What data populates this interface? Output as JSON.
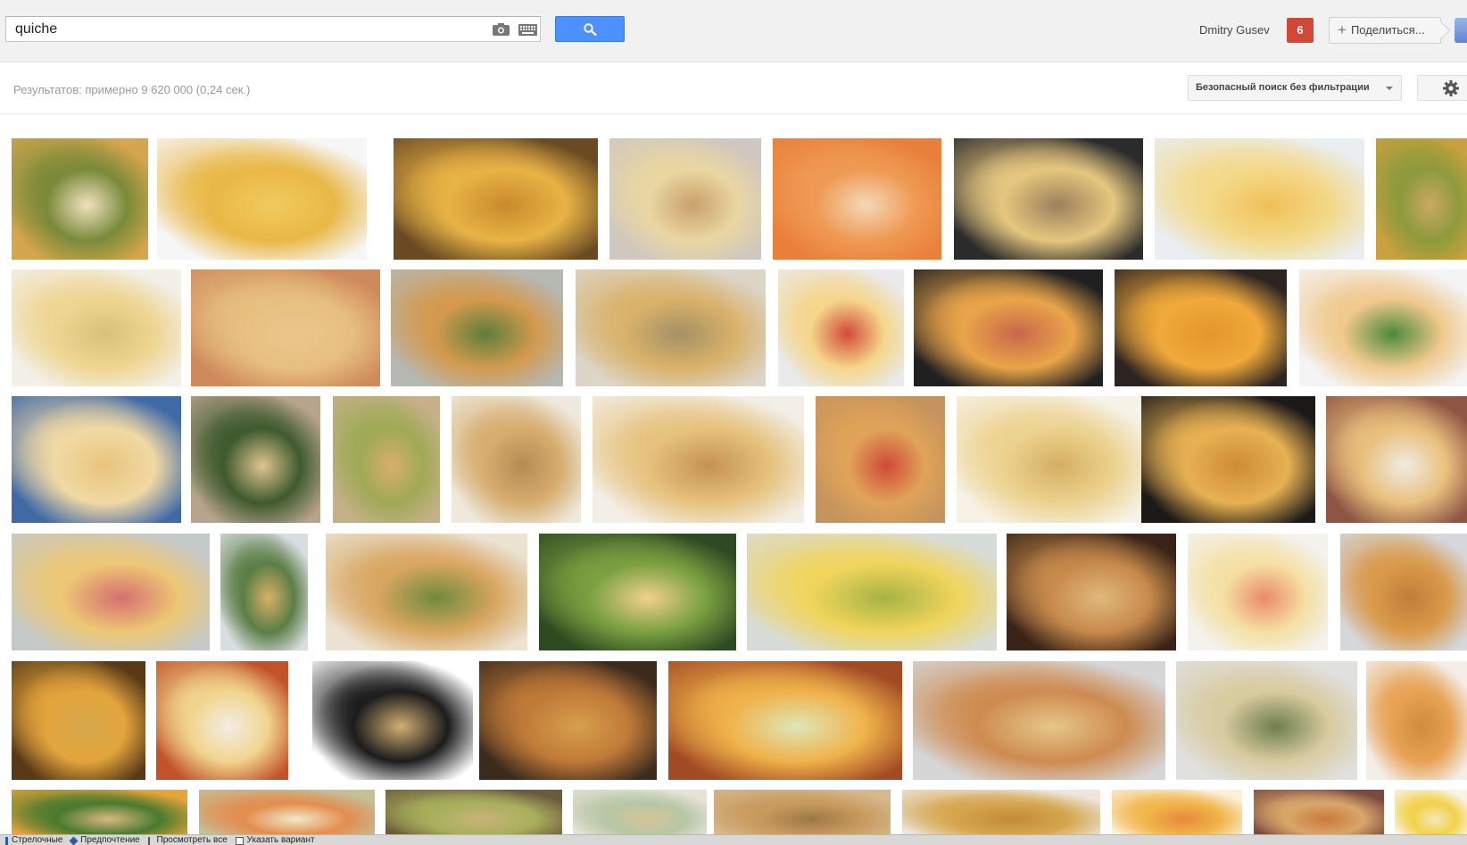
{
  "header": {
    "search_query": "quiche",
    "user_name": "Dmitry Gusev",
    "notifications": "6",
    "share_label": "Поделиться..."
  },
  "icons": {
    "camera": "camera-icon",
    "keyboard": "keyboard-icon",
    "search": "magnifier-icon",
    "settings": "gear-icon"
  },
  "colors": {
    "search_button": "#4d90fe",
    "notification_badge": "#d14836",
    "topbar_bg": "#f1f1f1"
  },
  "results": {
    "count_text": "Результатов: примерно 9 620 000 (0,24 сек.)",
    "safesearch_label": "Безопасный поиск без фильтрации"
  },
  "image_results": [
    [
      {
        "colors": [
          "#d5a64d",
          "#7a8a3a",
          "#f0e2c0"
        ]
      },
      {
        "colors": [
          "#f6f6f6",
          "#e9b845",
          "#f1ca5f"
        ]
      },
      {
        "colors": [
          "#6a4a22",
          "#e8b345",
          "#c98a2c"
        ]
      },
      {
        "colors": [
          "#cfc7c0",
          "#e9d6a2",
          "#c9a06a"
        ]
      },
      {
        "colors": [
          "#e87f3a",
          "#ef9a54",
          "#f4d8b8"
        ]
      },
      {
        "colors": [
          "#2c2b2b",
          "#e5c77f",
          "#9d7f5c"
        ]
      },
      {
        "colors": [
          "#eaeef0",
          "#f3d98a",
          "#f0c058"
        ]
      },
      {
        "colors": [
          "#c9a140",
          "#8e9a3c",
          "#caa962"
        ]
      }
    ],
    [
      {
        "colors": [
          "#f3f0e8",
          "#eed591",
          "#d8c07a"
        ]
      },
      {
        "colors": [
          "#cf8a5c",
          "#e7c080",
          "#eac58c"
        ]
      },
      {
        "colors": [
          "#b6b8b2",
          "#d39a4e",
          "#5d7e3d"
        ]
      },
      {
        "colors": [
          "#ddd5c8",
          "#d9b26a",
          "#a59066"
        ]
      },
      {
        "colors": [
          "#eaeaea",
          "#f5d68a",
          "#d24a3a"
        ]
      },
      {
        "colors": [
          "#202020",
          "#e9a549",
          "#c9674a"
        ]
      },
      {
        "colors": [
          "#2c2421",
          "#f0a93a",
          "#e3962c"
        ]
      },
      {
        "colors": [
          "#f4f4f4",
          "#f0c98d",
          "#4a8a3a"
        ]
      }
    ],
    [
      {
        "colors": [
          "#3f6aa6",
          "#f1d9a4",
          "#e8c47d"
        ]
      },
      {
        "colors": [
          "#b7a48c",
          "#3f5a2e",
          "#dfc590"
        ]
      },
      {
        "colors": [
          "#c6b08a",
          "#9faa56",
          "#d9ae6c"
        ]
      },
      {
        "colors": [
          "#efe9dd",
          "#d6ad6e",
          "#b58b55"
        ]
      },
      {
        "colors": [
          "#f3efe7",
          "#e6c27d",
          "#c49254"
        ]
      },
      {
        "colors": [
          "#c5935d",
          "#e0a359",
          "#cf4a3a"
        ]
      },
      {
        "colors": [
          "#f7f2e6",
          "#ecd28e",
          "#d5ae62"
        ]
      },
      {
        "colors": [
          "#1c1a18",
          "#e7b152",
          "#cf8b35"
        ]
      },
      {
        "colors": [
          "#8e5545",
          "#e9c07d",
          "#f1ebe2"
        ]
      }
    ],
    [
      {
        "colors": [
          "#c4c9c8",
          "#edc775",
          "#d66f6f"
        ]
      },
      {
        "colors": [
          "#d8dde0",
          "#5c7e46",
          "#d7b168"
        ]
      },
      {
        "colors": [
          "#ece2d2",
          "#d8a660",
          "#6f8a3c"
        ]
      },
      {
        "colors": [
          "#2d4a22",
          "#7aa040",
          "#f0d28a"
        ]
      },
      {
        "colors": [
          "#d8dcd9",
          "#f0d55c",
          "#a6b344"
        ]
      },
      {
        "colors": [
          "#3b2417",
          "#c78a4c",
          "#e1b87c"
        ]
      },
      {
        "colors": [
          "#f3f2ee",
          "#f5e0a3",
          "#e98a68"
        ]
      },
      {
        "colors": [
          "#d5d7db",
          "#d99a4a",
          "#c27c3a"
        ]
      }
    ],
    [
      {
        "colors": [
          "#5a3a16",
          "#e3a43c",
          "#d5a84a"
        ]
      },
      {
        "colors": [
          "#c1532a",
          "#f1d58e",
          "#f3ede4"
        ]
      },
      {
        "colors": [
          "#ffffff",
          "#1c1c1c",
          "#d2b073"
        ]
      },
      {
        "colors": [
          "#3c2a1c",
          "#c07a38",
          "#d6a04c"
        ]
      },
      {
        "colors": [
          "#a24a24",
          "#f0b24a",
          "#dde6b8"
        ]
      },
      {
        "colors": [
          "#d6d6d6",
          "#ce8b50",
          "#e6c689"
        ]
      },
      {
        "colors": [
          "#e0e0de",
          "#d8cba0",
          "#6d7e4c"
        ]
      },
      {
        "colors": [
          "#f3eee8",
          "#e7a253",
          "#cf8c3e"
        ]
      }
    ],
    [
      {
        "colors": [
          "#e6a43a",
          "#4a7a2e",
          "#d8b880"
        ]
      },
      {
        "colors": [
          "#c4c09a",
          "#e28e4e",
          "#f3e8c8"
        ]
      },
      {
        "colors": [
          "#6b5a3c",
          "#a8b05c",
          "#c9b27a"
        ]
      },
      {
        "colors": [
          "#e7e2d8",
          "#b7c7a5",
          "#d6c498"
        ]
      },
      {
        "colors": [
          "#d5b98c",
          "#c89a5e",
          "#9c7846"
        ]
      },
      {
        "colors": [
          "#ece6dc",
          "#d6a64e",
          "#c28a38"
        ]
      },
      {
        "colors": [
          "#fbf0d8",
          "#f1b64a",
          "#e9883a"
        ]
      },
      {
        "colors": [
          "#7a4a3e",
          "#d9a66a",
          "#c97a3a"
        ]
      },
      {
        "colors": [
          "#f7f4e4",
          "#f2d24a",
          "#f3e9b6"
        ]
      }
    ]
  ],
  "statusbar": {
    "item1": "Стрелочные",
    "item2": "Предпочтение",
    "item3": "Просмотреть все",
    "item4": "Указать вариант"
  }
}
